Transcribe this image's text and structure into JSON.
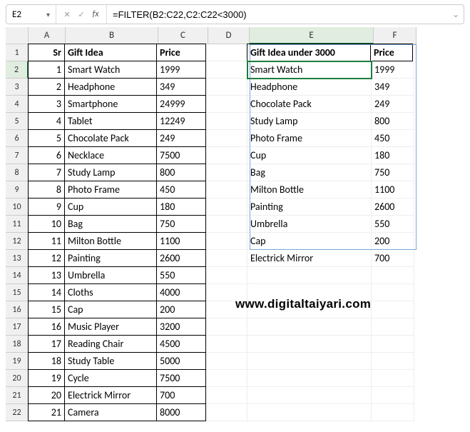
{
  "formula_bar": {
    "cell_ref": "E2",
    "fx_label": "fx",
    "formula": "=FILTER(B2:C22,C2:C22<3000)"
  },
  "columns": [
    "A",
    "B",
    "C",
    "D",
    "E",
    "F"
  ],
  "row_numbers": [
    1,
    2,
    3,
    4,
    5,
    6,
    7,
    8,
    9,
    10,
    11,
    12,
    13,
    14,
    15,
    16,
    17,
    18,
    19,
    20,
    21,
    22
  ],
  "table_left": {
    "headers": {
      "sr": "Sr",
      "gift": "Gift Idea",
      "price": "Price"
    },
    "rows": [
      {
        "sr": "1",
        "gift": "Smart Watch",
        "price": "1999"
      },
      {
        "sr": "2",
        "gift": "Headphone",
        "price": "349"
      },
      {
        "sr": "3",
        "gift": "Smartphone",
        "price": "24999"
      },
      {
        "sr": "4",
        "gift": "Tablet",
        "price": "12249"
      },
      {
        "sr": "5",
        "gift": "Chocolate Pack",
        "price": "249"
      },
      {
        "sr": "6",
        "gift": "Necklace",
        "price": "7500"
      },
      {
        "sr": "7",
        "gift": "Study Lamp",
        "price": "800"
      },
      {
        "sr": "8",
        "gift": "Photo Frame",
        "price": "450"
      },
      {
        "sr": "9",
        "gift": "Cup",
        "price": "180"
      },
      {
        "sr": "10",
        "gift": "Bag",
        "price": "750"
      },
      {
        "sr": "11",
        "gift": "Milton Bottle",
        "price": "1100"
      },
      {
        "sr": "12",
        "gift": "Painting",
        "price": "2600"
      },
      {
        "sr": "13",
        "gift": "Umbrella",
        "price": "550"
      },
      {
        "sr": "14",
        "gift": "Cloths",
        "price": "4000"
      },
      {
        "sr": "15",
        "gift": "Cap",
        "price": "200"
      },
      {
        "sr": "16",
        "gift": "Music Player",
        "price": "3200"
      },
      {
        "sr": "17",
        "gift": "Reading Chair",
        "price": "4500"
      },
      {
        "sr": "18",
        "gift": "Study Table",
        "price": "5000"
      },
      {
        "sr": "19",
        "gift": "Cycle",
        "price": "7500"
      },
      {
        "sr": "20",
        "gift": "Electrick Mirror",
        "price": "700"
      },
      {
        "sr": "21",
        "gift": "Camera",
        "price": "8000"
      }
    ]
  },
  "table_right": {
    "headers": {
      "gift": "Gift Idea under 3000",
      "price": "Price"
    },
    "rows": [
      {
        "gift": "Smart Watch",
        "price": "1999"
      },
      {
        "gift": "Headphone",
        "price": "349"
      },
      {
        "gift": "Chocolate Pack",
        "price": "249"
      },
      {
        "gift": "Study Lamp",
        "price": "800"
      },
      {
        "gift": "Photo Frame",
        "price": "450"
      },
      {
        "gift": "Cup",
        "price": "180"
      },
      {
        "gift": "Bag",
        "price": "750"
      },
      {
        "gift": "Milton Bottle",
        "price": "1100"
      },
      {
        "gift": "Painting",
        "price": "2600"
      },
      {
        "gift": "Umbrella",
        "price": "550"
      },
      {
        "gift": "Cap",
        "price": "200"
      },
      {
        "gift": "Electrick Mirror",
        "price": "700"
      }
    ]
  },
  "watermark": "www.digitaltaiyari.com"
}
